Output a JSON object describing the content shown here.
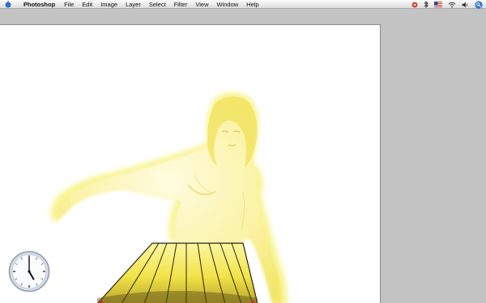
{
  "menubar": {
    "app_name": "Photoshop",
    "items": [
      "File",
      "Edit",
      "Image",
      "Layer",
      "Select",
      "Filter",
      "View",
      "Window",
      "Help"
    ]
  },
  "status_icons": [
    "cleaner-icon",
    "bluetooth-icon",
    "us-flag-icon",
    "wifi-icon",
    "volume-icon",
    "spotlight-icon"
  ],
  "canvas": {
    "subject": "glowing-yellow-figure-in-pleated-skirt",
    "glow_color": "#f6ee5a",
    "skirt_color": "#f2e34a"
  },
  "clock": {
    "hour": 5,
    "minute": 0
  }
}
